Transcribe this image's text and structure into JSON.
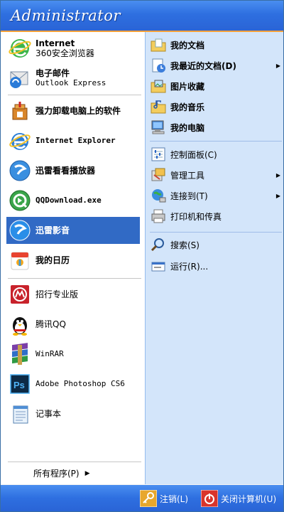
{
  "header": {
    "user_name": "Administrator"
  },
  "left": {
    "pinned": [
      {
        "name": "Internet",
        "sub": "360安全浏览器",
        "icon": "ie-green-icon"
      },
      {
        "name": "电子邮件",
        "sub": "Outlook Express",
        "icon": "email-icon"
      }
    ],
    "recent": [
      {
        "label": "强力卸载电脑上的软件",
        "icon": "uninstall-icon"
      },
      {
        "label": "Internet Explorer",
        "icon": "ie-icon"
      },
      {
        "label": "迅雷看看播放器",
        "icon": "xunlei-kankan-icon"
      },
      {
        "label": "QQDownload.exe",
        "icon": "qqdownload-icon"
      },
      {
        "label": "迅雷影音",
        "icon": "xunlei-yingyin-icon",
        "highlighted": true
      },
      {
        "label": "我的日历",
        "icon": "calendar-icon"
      }
    ],
    "more": [
      {
        "label": "招行专业版",
        "icon": "cmb-icon"
      },
      {
        "label": "腾讯QQ",
        "icon": "qq-penguin-icon"
      },
      {
        "label": "WinRAR",
        "icon": "winrar-icon"
      },
      {
        "label": "Adobe Photoshop CS6",
        "icon": "photoshop-icon"
      },
      {
        "label": "记事本",
        "icon": "notepad-icon"
      }
    ],
    "all_programs": "所有程序(P)"
  },
  "right": {
    "places": [
      {
        "label": "我的文档",
        "icon": "my-documents-icon"
      },
      {
        "label": "我最近的文档(D)",
        "icon": "recent-docs-icon",
        "submenu": true
      },
      {
        "label": "图片收藏",
        "icon": "my-pictures-icon"
      },
      {
        "label": "我的音乐",
        "icon": "my-music-icon"
      },
      {
        "label": "我的电脑",
        "icon": "my-computer-icon"
      }
    ],
    "system": [
      {
        "label": "控制面板(C)",
        "icon": "control-panel-icon"
      },
      {
        "label": "管理工具",
        "icon": "admin-tools-icon",
        "submenu": true
      },
      {
        "label": "连接到(T)",
        "icon": "connect-to-icon",
        "submenu": true
      },
      {
        "label": "打印机和传真",
        "icon": "printer-icon"
      }
    ],
    "tools": [
      {
        "label": "搜索(S)",
        "icon": "search-icon"
      },
      {
        "label": "运行(R)...",
        "icon": "run-icon"
      }
    ]
  },
  "footer": {
    "logoff": "注销(L)",
    "shutdown": "关闭计算机(U)"
  },
  "colors": {
    "header_blue": "#2e6fe0",
    "accent_orange": "#f6a23a",
    "highlight": "#316ac5",
    "right_pane": "#d3e5fa"
  }
}
